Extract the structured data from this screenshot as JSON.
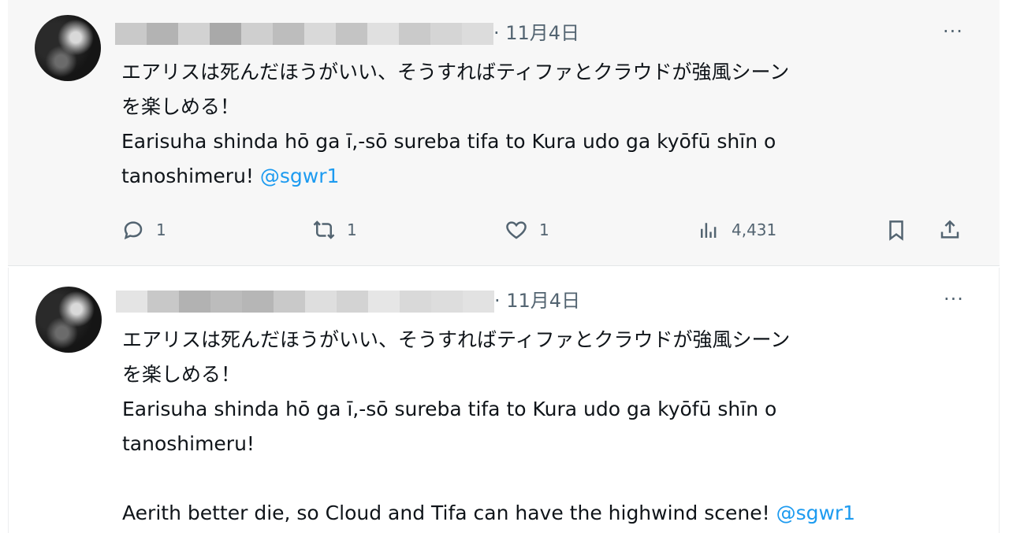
{
  "tweets": [
    {
      "date": "· 11月4日",
      "more": "···",
      "lines": [
        {
          "text": "エアリスは死んだほうがいい、そうすればティファとクラウドが強風シーン"
        },
        {
          "text": "を楽しめる！"
        },
        {
          "text": "Earisuha shinda hō ga ī,-sō sureba tifa to Kura udo ga kyōfū shīn o"
        },
        {
          "text": "tanoshimeru! ",
          "mention": "@sgwr1"
        }
      ],
      "actions": {
        "replies": "1",
        "retweets": "1",
        "likes": "1",
        "views": "4,431"
      }
    },
    {
      "date": "· 11月4日",
      "more": "···",
      "lines": [
        {
          "text": "エアリスは死んだほうがいい、そうすればティファとクラウドが強風シーン"
        },
        {
          "text": "を楽しめる！"
        },
        {
          "text": "Earisuha shinda hō ga ī,-sō sureba tifa to Kura udo ga kyōfū shīn o"
        },
        {
          "text": "tanoshimeru!"
        },
        {
          "text": ""
        },
        {
          "text": "Aerith better die, so Cloud and Tifa can have the highwind scene! ",
          "mention": "@sgwr1"
        }
      ]
    }
  ],
  "colors": {
    "accent": "#1d9bf0",
    "muted": "#536471",
    "text": "#0f1419"
  }
}
